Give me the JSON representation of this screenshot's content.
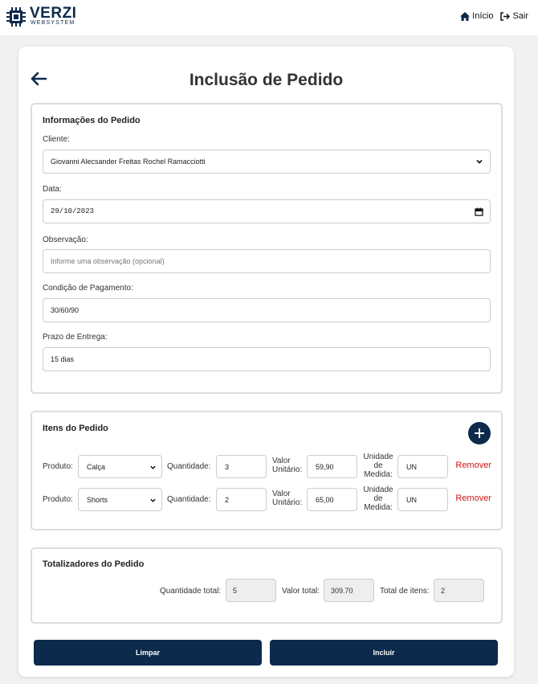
{
  "header": {
    "logo_title": "VERZI",
    "logo_subtitle": "WEBSYSTEM",
    "nav": {
      "home_label": "Início",
      "logout_label": "Sair"
    }
  },
  "page": {
    "title": "Inclusão de Pedido"
  },
  "order_info": {
    "title": "Informações do Pedido",
    "client_label": "Cliente:",
    "client_value": "Giovanni Alecsander Freitas Rochel Ramacciotti",
    "date_label": "Data:",
    "date_value": "29/10/2023",
    "observation_label": "Observação:",
    "observation_placeholder": "Informe uma observação (opcional)",
    "payment_label": "Condição de Pagamento:",
    "payment_value": "30/60/90",
    "delivery_label": "Prazo de Entrega:",
    "delivery_value": "15 dias"
  },
  "items": {
    "title": "Itens do Pedido",
    "labels": {
      "product": "Produto:",
      "quantity": "Quantidade:",
      "unit_value_1": "Valor",
      "unit_value_2": "Unitário:",
      "unit_1": "Unidade",
      "unit_2": "de",
      "unit_3": "Medida:",
      "remove": "Remover"
    },
    "rows": [
      {
        "product": "Calça",
        "quantity": "3",
        "unit_value": "59,90",
        "unit": "UN"
      },
      {
        "product": "Shorts",
        "quantity": "2",
        "unit_value": "65,00",
        "unit": "UN"
      }
    ]
  },
  "totals": {
    "title": "Totalizadores do Pedido",
    "quantity_label": "Quantidade total:",
    "quantity_value": "5",
    "value_label": "Valor total:",
    "value_value": "309.70",
    "items_label": "Total de itens:",
    "items_value": "2"
  },
  "actions": {
    "clear_label": "Limpar",
    "submit_label": "Incluir"
  },
  "colors": {
    "primary": "#0c2a4b",
    "danger": "#d21414",
    "background": "#f1f1f1"
  }
}
